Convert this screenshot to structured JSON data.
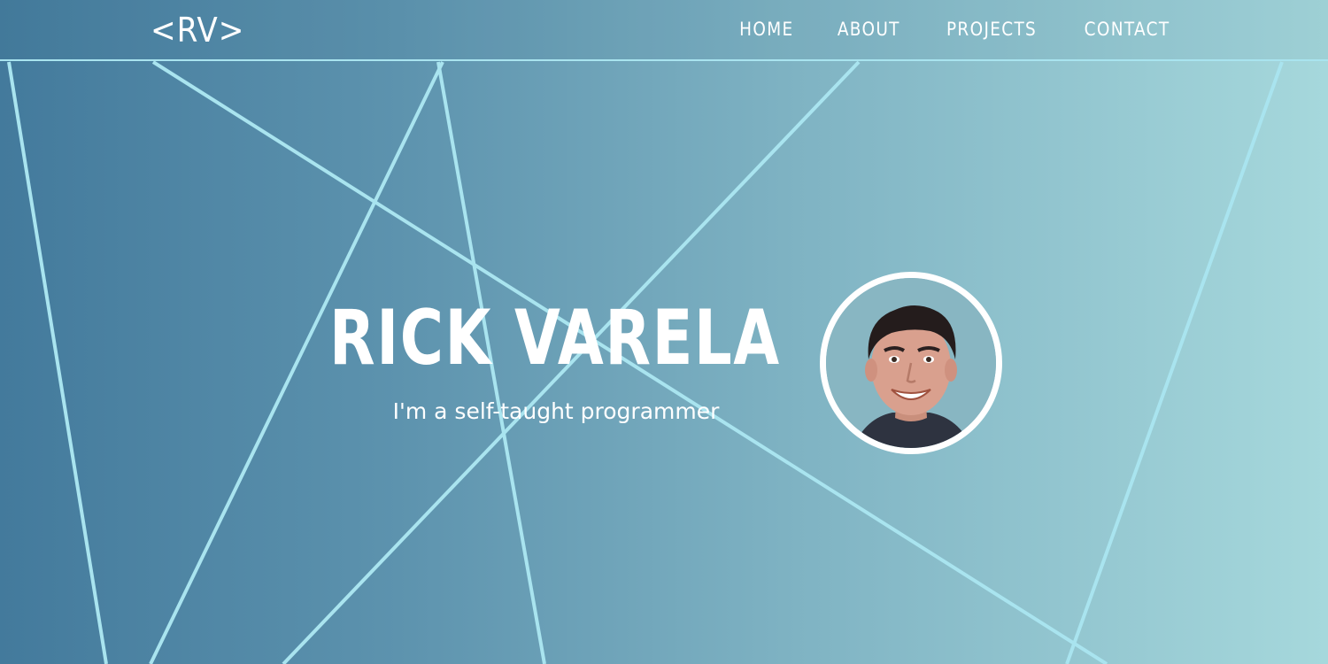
{
  "header": {
    "logo": "<RV>",
    "nav": [
      "HOME",
      "ABOUT",
      "PROJECTS",
      "CONTACT"
    ]
  },
  "hero": {
    "name": "RICK VARELA",
    "tagline": "I'm a self-taught programmer"
  },
  "colors": {
    "gradient_start": "#437a9c",
    "gradient_end": "#a6d8dc",
    "line_accent": "#a9e4ef",
    "text": "#ffffff"
  },
  "icons": [
    "profile-photo"
  ]
}
